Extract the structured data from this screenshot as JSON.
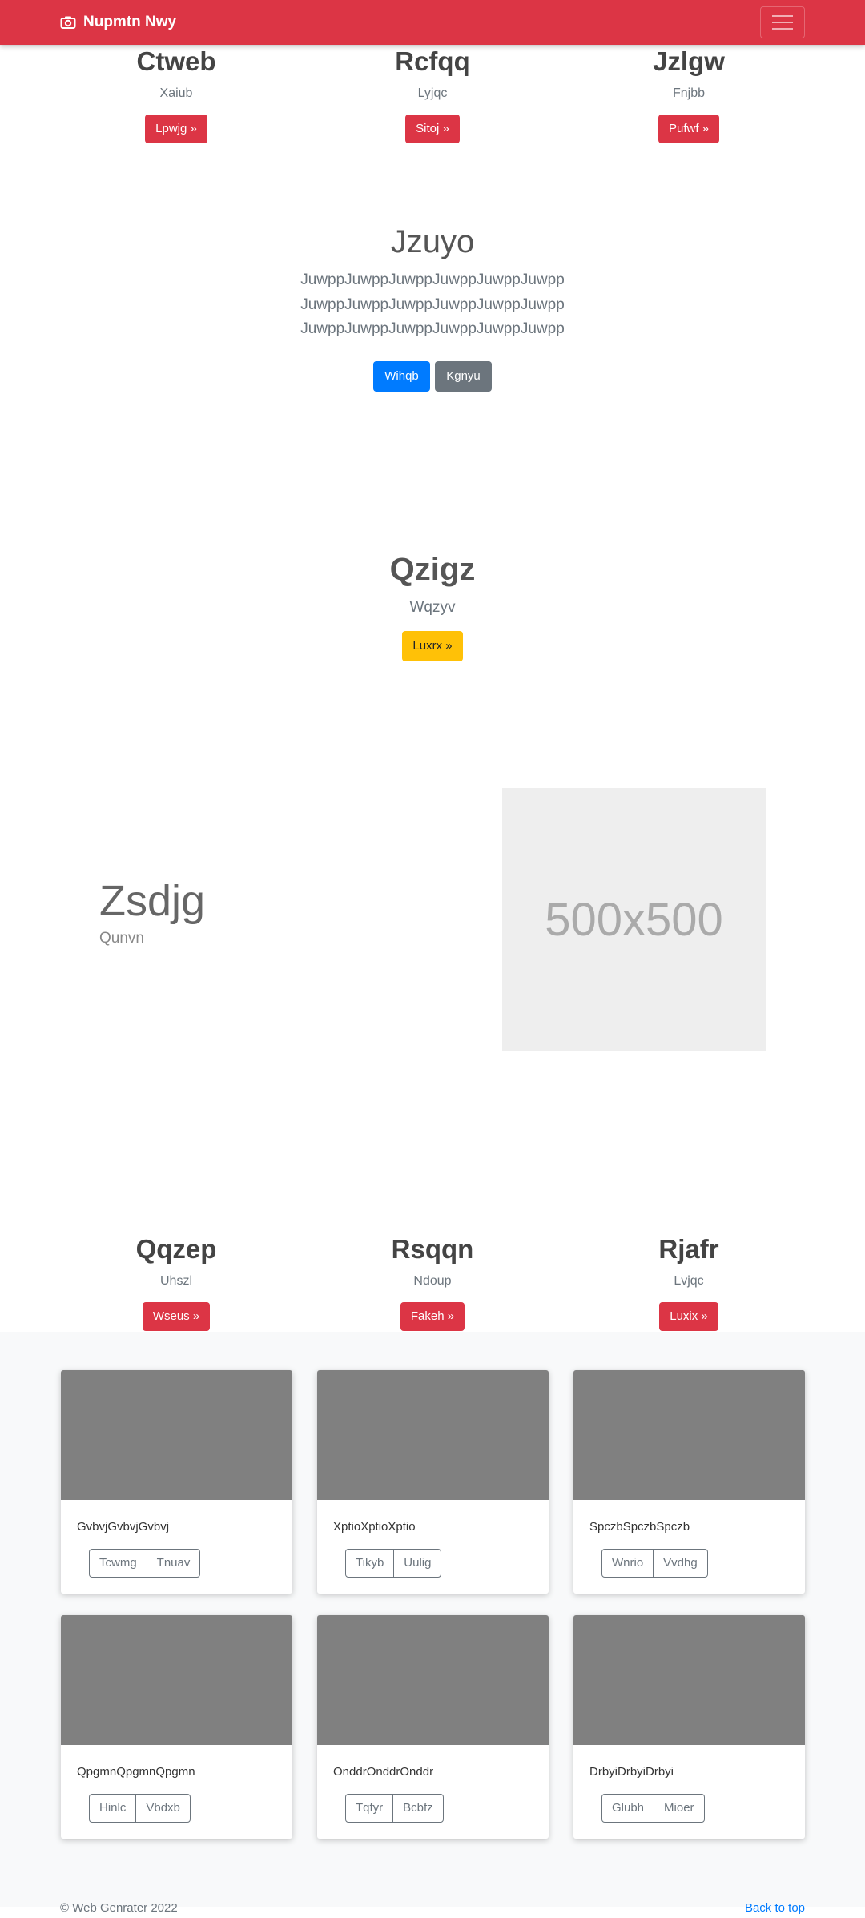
{
  "navbar": {
    "brand": "Nupmtn Nwy"
  },
  "top_columns": [
    {
      "title": "Ctweb",
      "text": "Xaiub",
      "button": "Lpwjg »"
    },
    {
      "title": "Rcfqq",
      "text": "Lyjqc",
      "button": "Sitoj »"
    },
    {
      "title": "Jzlgw",
      "text": "Fnjbb",
      "button": "Pufwf »"
    }
  ],
  "hero": {
    "title": "Jzuyo",
    "lead_lines": [
      "JuwppJuwppJuwppJuwppJuwppJuwpp",
      "JuwppJuwppJuwppJuwppJuwppJuwpp",
      "JuwppJuwppJuwppJuwppJuwppJuwpp"
    ],
    "primary_button": "Wihqb",
    "secondary_button": "Kgnyu"
  },
  "promo": {
    "title": "Qzigz",
    "text": "Wqzyv",
    "button": "Luxrx »"
  },
  "feature": {
    "title": "Zsdjg",
    "subtitle": "Qunvn",
    "placeholder": "500x500"
  },
  "bottom_columns": [
    {
      "title": "Qqzep",
      "text": "Uhszl",
      "button": "Wseus »"
    },
    {
      "title": "Rsqqn",
      "text": "Ndoup",
      "button": "Fakeh »"
    },
    {
      "title": "Rjafr",
      "text": "Lvjqc",
      "button": "Luxix »"
    }
  ],
  "cards": [
    {
      "text": "GvbvjGvbvjGvbvj",
      "btn1": "Tcwmg",
      "btn2": "Tnuav"
    },
    {
      "text": "XptioXptioXptio",
      "btn1": "Tikyb",
      "btn2": "Uulig"
    },
    {
      "text": "SpczbSpczbSpczb",
      "btn1": "Wnrio",
      "btn2": "Vvdhg"
    },
    {
      "text": "QpgmnQpgmnQpgmn",
      "btn1": "Hinlc",
      "btn2": "Vbdxb"
    },
    {
      "text": "OnddrOnddrOnddr",
      "btn1": "Tqfyr",
      "btn2": "Bcbfz"
    },
    {
      "text": "DrbyiDrbyiDrbyi",
      "btn1": "Glubh",
      "btn2": "Mioer"
    }
  ],
  "footer": {
    "copyright": "© Web Genrater 2022",
    "back_to_top": "Back to top"
  }
}
